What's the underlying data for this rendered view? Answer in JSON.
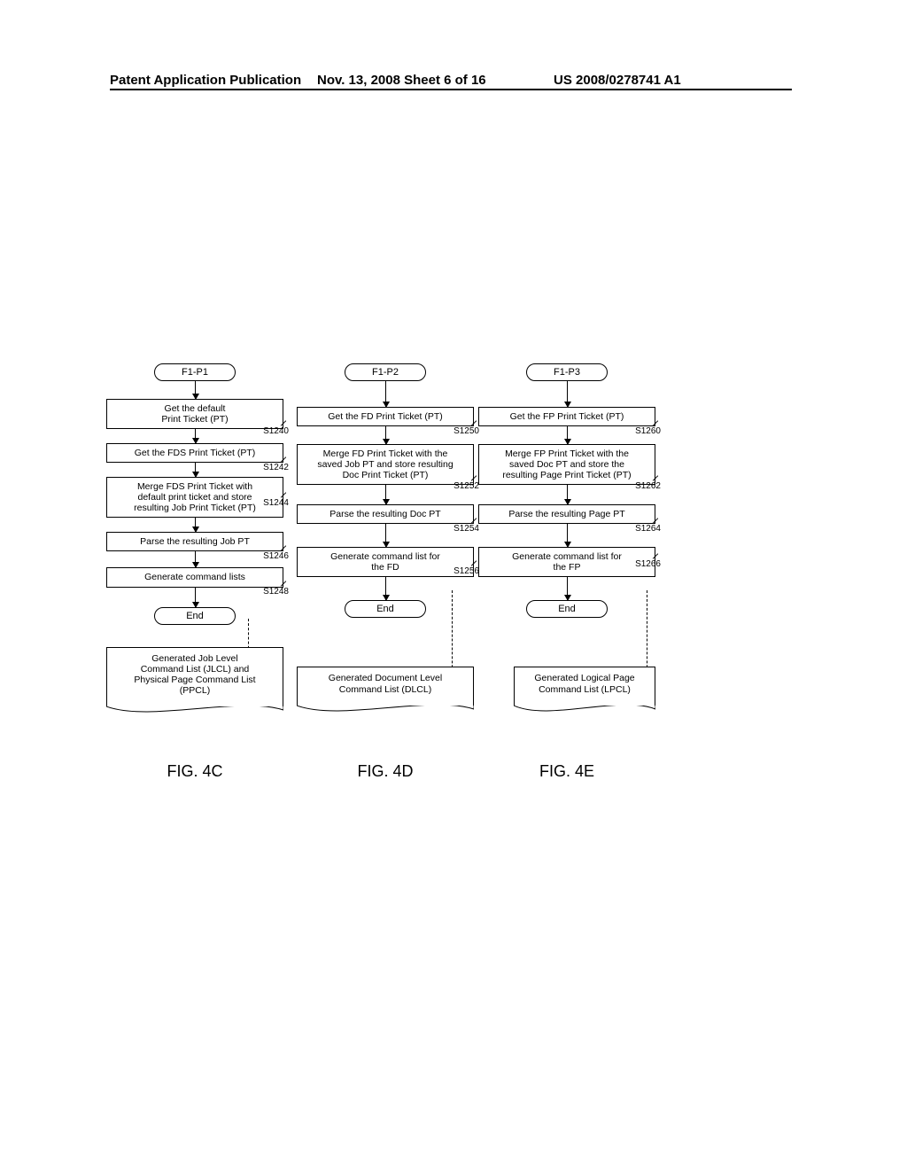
{
  "header": {
    "left": "Patent Application Publication",
    "mid": "Nov. 13, 2008  Sheet 6 of 16",
    "right": "US 2008/0278741 A1"
  },
  "col1": {
    "start": "F1-P1",
    "steps": [
      {
        "text": "Get the default\nPrint Ticket (PT)",
        "label": "S1240"
      },
      {
        "text": "Get the FDS Print Ticket (PT)",
        "label": "S1242"
      },
      {
        "text": "Merge FDS Print Ticket with\ndefault print ticket and store\nresulting Job Print Ticket (PT)",
        "label": "S1244"
      },
      {
        "text": "Parse the resulting Job PT",
        "label": "S1246"
      },
      {
        "text": "Generate command lists",
        "label": "S1248"
      }
    ],
    "end": "End",
    "output": "Generated Job Level\nCommand List (JLCL) and\nPhysical Page Command List\n(PPCL)",
    "figure": "FIG. 4C"
  },
  "col2": {
    "start": "F1-P2",
    "steps": [
      {
        "text": "Get the FD Print Ticket (PT)",
        "label": "S1250"
      },
      {
        "text": "Merge FD Print Ticket with the\nsaved Job PT and store resulting\nDoc Print Ticket (PT)",
        "label": "S1252"
      },
      {
        "text": "Parse the resulting Doc PT",
        "label": "S1254"
      },
      {
        "text": "Generate command list for\nthe FD",
        "label": "S1256"
      }
    ],
    "end": "End",
    "output": "Generated Document Level\nCommand List (DLCL)",
    "figure": "FIG. 4D"
  },
  "col3": {
    "start": "F1-P3",
    "steps": [
      {
        "text": "Get the FP Print Ticket (PT)",
        "label": "S1260"
      },
      {
        "text": "Merge FP Print Ticket with the\nsaved Doc PT and store the\nresulting Page Print Ticket (PT)",
        "label": "S1262"
      },
      {
        "text": "Parse the resulting Page PT",
        "label": "S1264"
      },
      {
        "text": "Generate command list for\nthe FP",
        "label": "S1266"
      }
    ],
    "end": "End",
    "output": "Generated Logical Page\nCommand List (LPCL)",
    "figure": "FIG. 4E"
  }
}
